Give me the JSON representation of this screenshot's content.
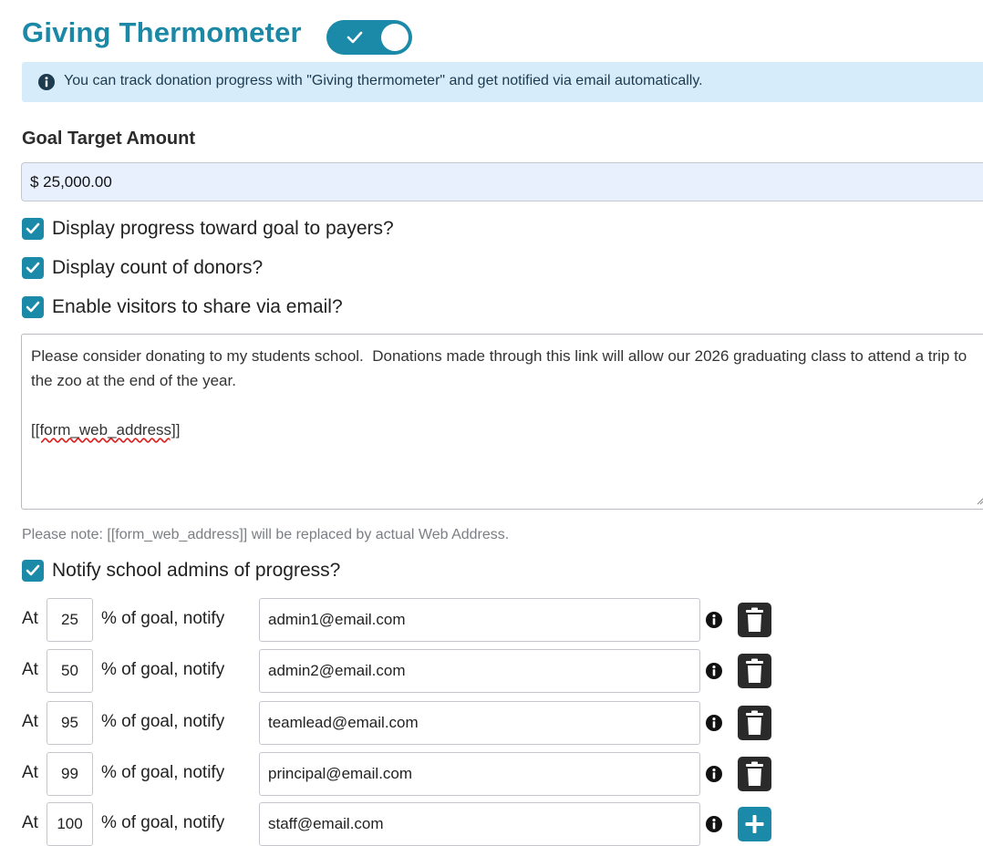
{
  "section": {
    "title": "Giving Thermometer",
    "enabled": true
  },
  "info": {
    "text": "You can track donation progress with \"Giving thermometer\" and get notified via email automatically."
  },
  "goal": {
    "label": "Goal Target Amount",
    "value": "$ 25,000.00"
  },
  "options": {
    "display_progress": {
      "label": "Display progress toward goal to payers?",
      "checked": true
    },
    "display_count": {
      "label": "Display count of donors?",
      "checked": true
    },
    "share_email": {
      "label": "Enable visitors to share via email?",
      "checked": true
    }
  },
  "message": {
    "line1": "Please consider donating to my students school.  Donations made through this link will allow our 2026 graduating class to attend a trip to the zoo at the end of the year.",
    "tag": "[[form_web_address]]"
  },
  "note": "Please note: [[form_web_address]] will be replaced by actual Web Address.",
  "notify": {
    "label": "Notify school admins of progress?",
    "checked": true,
    "at_label": "At",
    "mid_label": "% of goal, notify",
    "rows": [
      {
        "percent": "25",
        "email": "admin1@email.com",
        "action": "trash-icon"
      },
      {
        "percent": "50",
        "email": "admin2@email.com",
        "action": "trash-icon"
      },
      {
        "percent": "95",
        "email": "teamlead@email.com",
        "action": "trash-icon"
      },
      {
        "percent": "99",
        "email": "principal@email.com",
        "action": "trash-icon"
      },
      {
        "percent": "100",
        "email": "staff@email.com",
        "action": "plus-icon"
      }
    ]
  },
  "colors": {
    "accent": "#1a8aa8",
    "title": "#1b88a6",
    "info_bg": "#d7ecfb",
    "input_bg": "#e8f0fd",
    "trash": "#2a2a2a"
  }
}
